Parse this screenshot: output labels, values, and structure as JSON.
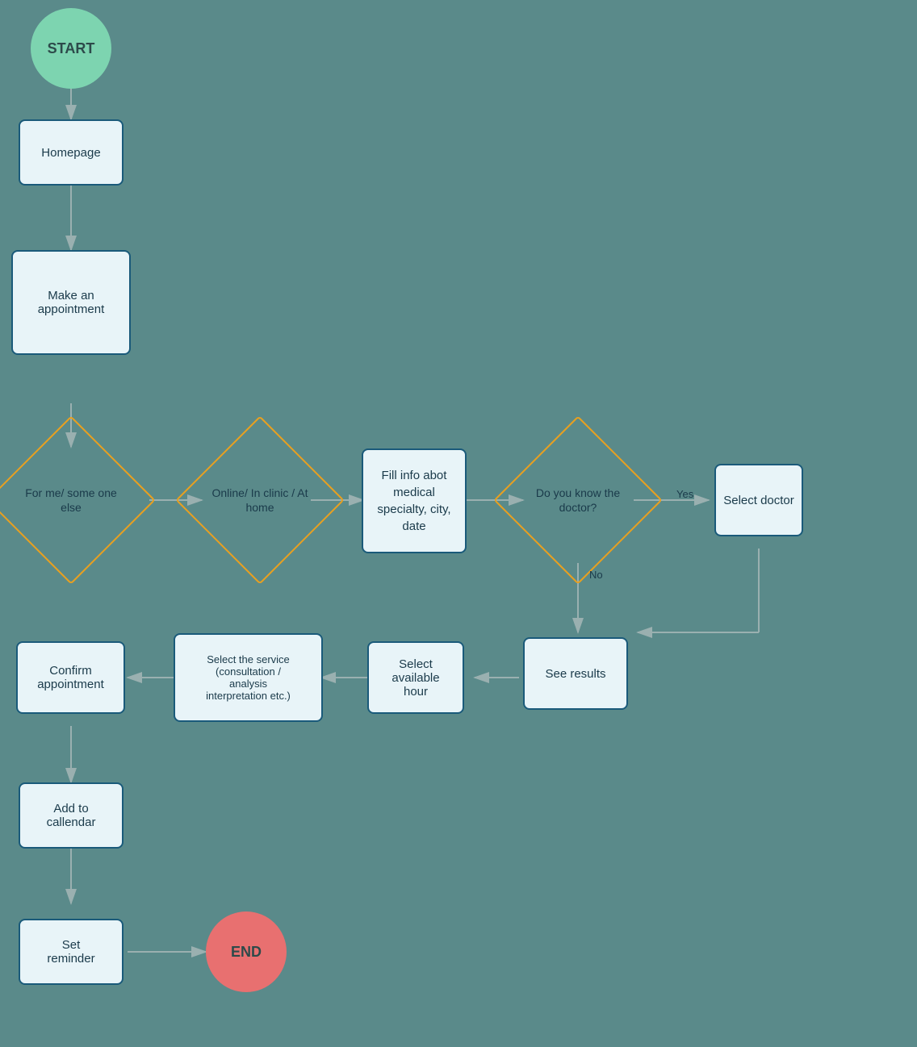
{
  "nodes": {
    "start": {
      "label": "START"
    },
    "end": {
      "label": "END"
    },
    "homepage": {
      "label": "Homepage"
    },
    "make_appointment": {
      "label": "Make an appointment"
    },
    "for_me": {
      "label": "For me/\nsome\none else"
    },
    "online_in_clinic": {
      "label": "Online/\nIn clinic /\nAt home"
    },
    "fill_info": {
      "label": "Fill info abot\nmedical\nspecialty, city,\ndate"
    },
    "do_you_know": {
      "label": "Do you\nknow the\ndoctor?"
    },
    "select_doctor": {
      "label": "Select\ndoctor"
    },
    "see_results": {
      "label": "See\nresults"
    },
    "select_available_hour": {
      "label": "Select\navailable\nhour"
    },
    "select_service": {
      "label": "Select the service\n(consultation /\nanalysis\ninterpretation etc.)"
    },
    "confirm_appointment": {
      "label": "Confirm\nappointment"
    },
    "add_to_calendar": {
      "label": "Add to\ncallendar"
    },
    "set_reminder": {
      "label": "Set\nreminder"
    }
  },
  "labels": {
    "yes": "Yes",
    "no": "No"
  },
  "colors": {
    "background": "#5a8a8a",
    "start_fill": "#7dd4b0",
    "end_fill": "#e87070",
    "rect_border": "#1a5a7a",
    "rect_bg": "#e8f4f8",
    "diamond_border": "#e8a020",
    "text": "#1a3a4a",
    "arrow": "#9ab0b0"
  }
}
